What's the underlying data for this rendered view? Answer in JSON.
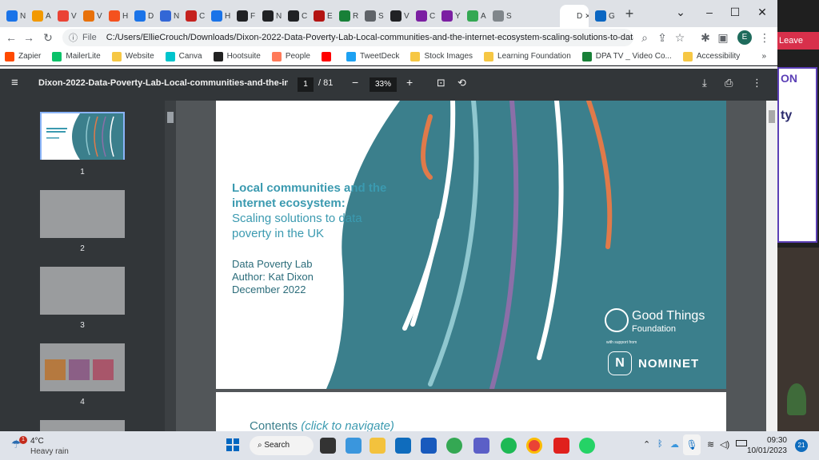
{
  "tabs": [
    {
      "label": "N",
      "color": "#1a73e8"
    },
    {
      "label": "A",
      "color": "#f29900"
    },
    {
      "label": "V",
      "color": "#ea4335"
    },
    {
      "label": "V",
      "color": "#e8710a"
    },
    {
      "label": "H",
      "color": "#f4511e"
    },
    {
      "label": "D",
      "color": "#1a73e8"
    },
    {
      "label": "N",
      "color": "#3367d6"
    },
    {
      "label": "C",
      "color": "#c5221f"
    },
    {
      "label": "H",
      "color": "#1a73e8"
    },
    {
      "label": "F",
      "color": "#202124"
    },
    {
      "label": "N",
      "color": "#202124"
    },
    {
      "label": "C",
      "color": "#202124"
    },
    {
      "label": "E",
      "color": "#b31412"
    },
    {
      "label": "R",
      "color": "#188038"
    },
    {
      "label": "S",
      "color": "#5f6368"
    },
    {
      "label": "V",
      "color": "#202124"
    },
    {
      "label": "C",
      "color": "#7b1fa2"
    },
    {
      "label": "Y",
      "color": "#7b1fa2"
    },
    {
      "label": "A",
      "color": "#34a853"
    },
    {
      "label": "S",
      "color": "#80868b"
    },
    {
      "label": "D",
      "color": "#ffffff",
      "active": true
    },
    {
      "label": "G",
      "color": "#0a66c2"
    }
  ],
  "omnibox": {
    "scheme": "File",
    "url": "C:/Users/EllieCrouch/Downloads/Dixon-2022-Data-Poverty-Lab-Local-communities-and-the-internet-ecosystem-scaling-solutions-to-data-p..."
  },
  "profile_initial": "E",
  "bookmarks": [
    {
      "label": "Zapier",
      "color": "#ff4a00"
    },
    {
      "label": "MailerLite",
      "color": "#09c269"
    },
    {
      "label": "Website",
      "color": "#f6c744"
    },
    {
      "label": "Canva",
      "color": "#00c4cc"
    },
    {
      "label": "Hootsuite",
      "color": "#222222"
    },
    {
      "label": "People",
      "color": "#ff7a59"
    },
    {
      "label": "",
      "color": "#ff0000"
    },
    {
      "label": "TweetDeck",
      "color": "#1da1f2"
    },
    {
      "label": "Stock Images",
      "color": "#f6c744"
    },
    {
      "label": "Learning Foundation",
      "color": "#f6c744"
    },
    {
      "label": "DPA TV _ Video Co...",
      "color": "#188038"
    },
    {
      "label": "Accessibility",
      "color": "#f6c744"
    }
  ],
  "bookmarks_more": "»",
  "pdf": {
    "title": "Dixon-2022-Data-Poverty-Lab-Local-communities-and-the-intern...",
    "page_current": "1",
    "page_total": "/ 81",
    "zoom": "33%",
    "thumbnails": [
      "1",
      "2",
      "3",
      "4"
    ]
  },
  "page1": {
    "title_bold": "Local communities and the internet ecosystem:",
    "title_light": "Scaling solutions to data poverty in the UK",
    "org": "Data Poverty Lab",
    "author": "Author: Kat Dixon",
    "date": "December 2022",
    "brand_line1": "Good Things",
    "brand_line2": "Foundation",
    "support": "with support from",
    "nominet": "NOMINET"
  },
  "page2_heading": "Contents",
  "page2_heading_link": "(click to navigate)",
  "right_strip": {
    "leave": "Leave",
    "on": "ON",
    "ty": "ty"
  },
  "taskbar": {
    "weather_temp": "4°C",
    "weather_desc": "Heavy rain",
    "weather_badge": "1",
    "search": "Search",
    "time": "09:30",
    "date": "10/01/2023",
    "notif": "21"
  },
  "colors": {
    "teal": "#3b7f8c",
    "orange": "#e07a4a",
    "purple": "#8b6fa8",
    "light": "#8fc7cf",
    "title": "#3b9ab0"
  }
}
